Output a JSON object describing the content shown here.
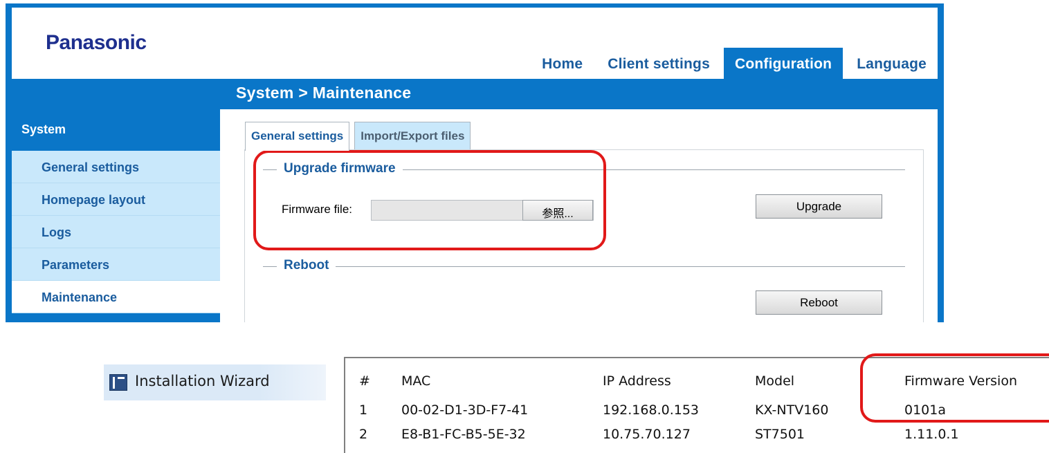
{
  "brand": "Panasonic",
  "topnav": {
    "tabs": [
      "Home",
      "Client settings",
      "Configuration",
      "Language"
    ],
    "active": "Configuration"
  },
  "breadcrumb": "System > Maintenance",
  "sidebar": {
    "heading": "System",
    "items": [
      "General settings",
      "Homepage layout",
      "Logs",
      "Parameters",
      "Maintenance"
    ],
    "active": "Maintenance"
  },
  "content_tabs": {
    "tabs": [
      "General settings",
      "Import/Export files"
    ],
    "active": "General settings"
  },
  "upgrade": {
    "legend": "Upgrade firmware",
    "file_label": "Firmware file:",
    "file_value": "",
    "browse_label": "参照...",
    "button_label": "Upgrade"
  },
  "reboot": {
    "legend": "Reboot",
    "button_label": "Reboot"
  },
  "wizard": {
    "label": "Installation Wizard",
    "icon": "wizard-app-icon"
  },
  "device_table": {
    "headers": [
      "#",
      "MAC",
      "IP Address",
      "Model",
      "Firmware Version"
    ],
    "rows": [
      [
        "1",
        "00-02-D1-3D-F7-41",
        "192.168.0.153",
        "KX-NTV160",
        "0101a"
      ],
      [
        "2",
        "E8-B1-FC-B5-5E-32",
        "10.75.70.127",
        "ST7501",
        "1.11.0.1"
      ]
    ]
  },
  "colors": {
    "accent": "#0a76c8",
    "sidebar_bg": "#c9e8fb",
    "link_text": "#1a5c9e",
    "highlight": "#e11919"
  }
}
